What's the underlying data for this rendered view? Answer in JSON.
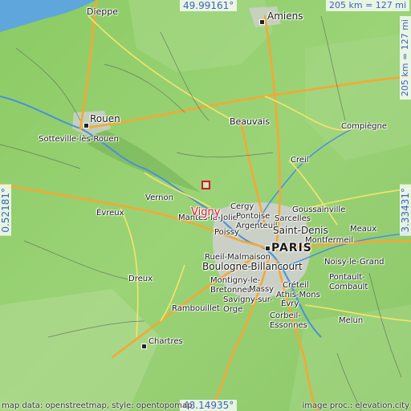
{
  "map": {
    "colors": {
      "sea": "#5fa6dc",
      "land_low": "#7fc25b",
      "land_mid": "#9dd17a",
      "land_high": "#c8d9a0",
      "motorway": "#f6a733",
      "primary": "#f7e46b",
      "road": "#555555",
      "urban": "#c9c9c9",
      "river": "#4a90d9",
      "highlight": "#d8162c"
    },
    "coordinates": {
      "top": "49.99161°",
      "bottom": "48.14935°",
      "left": "0.52181°",
      "right": "3.33431°"
    },
    "scale": {
      "horizontal": "205 km = 127 mi",
      "vertical": "205 km = 127 mi"
    },
    "highlight_place": "Vigny",
    "places": {
      "dieppe": "Dieppe",
      "amiens": "Amiens",
      "rouen": "Rouen",
      "sotteville": "Sotteville-lès-Rouen",
      "beauvais": "Beauvais",
      "compiegne": "Compiègne",
      "creil": "Creil",
      "vernon": "Vernon",
      "evreux": "Évreux",
      "cergy": "Cergy",
      "goussainville": "Goussainville",
      "mantes": "Mantes-la-Jolie",
      "pontoise": "Pontoise",
      "sarcelles": "Sarcelles",
      "argenteuil": "Argenteuil",
      "poissy": "Poissy",
      "saint_denis": "Saint-Denis",
      "meaux": "Meaux",
      "montfermeil": "Montfermeil",
      "paris": "PARIS",
      "rueil": "Rueil-Malmaison",
      "noisy": "Noisy-le-Grand",
      "boulogne": "Boulogne-Billancourt",
      "pontault": "Pontault-Combault",
      "dreux": "Dreux",
      "montigny": "Montigny-le-Bretonneux",
      "massy": "Massy",
      "creteil": "Créteil",
      "athis": "Athis-Mons",
      "savigny": "Savigny-sur-Orge",
      "evry": "Évry",
      "rambouillet": "Rambouillet",
      "corbeil": "Corbeil-Essonnes",
      "melun": "Melun",
      "chartres": "Chartres"
    },
    "attribution_left": "map data: openstreetmap, style: opentopomap",
    "attribution_right": "image proc.: elevation.city"
  }
}
